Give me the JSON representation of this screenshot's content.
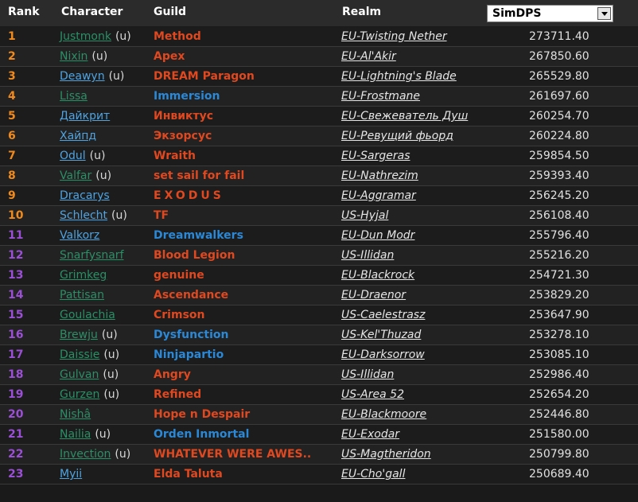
{
  "header": {
    "rank": "Rank",
    "character": "Character",
    "guild": "Guild",
    "realm": "Realm",
    "metric": "SimDPS"
  },
  "colors": {
    "rank_top10": "#f08a1c",
    "rank_rest": "#9b4fd6",
    "guild_red": "#e0481f",
    "guild_blue": "#2a88d6",
    "char_green": "#2b8f67",
    "char_blue": "#4fa3e0"
  },
  "rows": [
    {
      "rank": "1",
      "character": "Justmonk",
      "u": "(u)",
      "guild": "Method",
      "realm": "EU-Twisting Nether",
      "score": "273711.40",
      "char_color": "green",
      "guild_color": "red",
      "rank_color": "orange"
    },
    {
      "rank": "2",
      "character": "Nixin",
      "u": "(u)",
      "guild": "Apex",
      "realm": "EU-Al'Akir",
      "score": "267850.60",
      "char_color": "green",
      "guild_color": "red",
      "rank_color": "orange"
    },
    {
      "rank": "3",
      "character": "Deawyn",
      "u": "(u)",
      "guild": "DREAM Paragon",
      "realm": "EU-Lightning's Blade",
      "score": "265529.80",
      "char_color": "blue",
      "guild_color": "red",
      "rank_color": "orange"
    },
    {
      "rank": "4",
      "character": "Lissa",
      "u": "",
      "guild": "Immersion",
      "realm": "EU-Frostmane",
      "score": "261697.60",
      "char_color": "green",
      "guild_color": "blue",
      "rank_color": "orange"
    },
    {
      "rank": "5",
      "character": "Дайкрит",
      "u": "",
      "guild": "Инвиктус",
      "realm": "EU-Свежеватель Душ",
      "score": "260254.70",
      "char_color": "blue",
      "guild_color": "red",
      "rank_color": "orange"
    },
    {
      "rank": "6",
      "character": "Хайпд",
      "u": "",
      "guild": "Экзорсус",
      "realm": "EU-Ревущий фьорд",
      "score": "260224.80",
      "char_color": "blue",
      "guild_color": "red",
      "rank_color": "orange"
    },
    {
      "rank": "7",
      "character": "Odul",
      "u": "(u)",
      "guild": "Wraith",
      "realm": "EU-Sargeras",
      "score": "259854.50",
      "char_color": "blue",
      "guild_color": "red",
      "rank_color": "orange"
    },
    {
      "rank": "8",
      "character": "Valfar",
      "u": "(u)",
      "guild": "set sail for fail",
      "realm": "EU-Nathrezim",
      "score": "259393.40",
      "char_color": "green",
      "guild_color": "red",
      "rank_color": "orange"
    },
    {
      "rank": "9",
      "character": "Dracarys",
      "u": "",
      "guild": "EXODUS",
      "realm": "EU-Aggramar",
      "score": "256245.20",
      "char_color": "blue",
      "guild_color": "red",
      "rank_color": "orange",
      "wide": true
    },
    {
      "rank": "10",
      "character": "Schlecht",
      "u": "(u)",
      "guild": "TF",
      "realm": "US-Hyjal",
      "score": "256108.40",
      "char_color": "blue",
      "guild_color": "red",
      "rank_color": "orange"
    },
    {
      "rank": "11",
      "character": "Valkorz",
      "u": "",
      "guild": "Dreamwalkers",
      "realm": "EU-Dun Modr",
      "score": "255796.40",
      "char_color": "blue",
      "guild_color": "blue",
      "rank_color": "purple"
    },
    {
      "rank": "12",
      "character": "Snarfysnarf",
      "u": "",
      "guild": "Blood Legion",
      "realm": "US-Illidan",
      "score": "255216.20",
      "char_color": "green",
      "guild_color": "red",
      "rank_color": "purple"
    },
    {
      "rank": "13",
      "character": "Grimkeg",
      "u": "",
      "guild": "genuine",
      "realm": "EU-Blackrock",
      "score": "254721.30",
      "char_color": "green",
      "guild_color": "red",
      "rank_color": "purple"
    },
    {
      "rank": "14",
      "character": "Pattisan",
      "u": "",
      "guild": "Ascendance",
      "realm": "EU-Draenor",
      "score": "253829.20",
      "char_color": "green",
      "guild_color": "red",
      "rank_color": "purple"
    },
    {
      "rank": "15",
      "character": "Goulachia",
      "u": "",
      "guild": "Crimson",
      "realm": "US-Caelestrasz",
      "score": "253647.90",
      "char_color": "green",
      "guild_color": "red",
      "rank_color": "purple"
    },
    {
      "rank": "16",
      "character": "Brewju",
      "u": "(u)",
      "guild": "Dysfunction",
      "realm": "US-Kel'Thuzad",
      "score": "253278.10",
      "char_color": "green",
      "guild_color": "blue",
      "rank_color": "purple"
    },
    {
      "rank": "17",
      "character": "Daissie",
      "u": "(u)",
      "guild": "Ninjapartio",
      "realm": "EU-Darksorrow",
      "score": "253085.10",
      "char_color": "green",
      "guild_color": "blue",
      "rank_color": "purple"
    },
    {
      "rank": "18",
      "character": "Gulvan",
      "u": "(u)",
      "guild": "Angry",
      "realm": "US-Illidan",
      "score": "252986.40",
      "char_color": "green",
      "guild_color": "red",
      "rank_color": "purple"
    },
    {
      "rank": "19",
      "character": "Gurzen",
      "u": "(u)",
      "guild": "Refined",
      "realm": "US-Area 52",
      "score": "252654.20",
      "char_color": "green",
      "guild_color": "red",
      "rank_color": "purple"
    },
    {
      "rank": "20",
      "character": "Nishâ",
      "u": "",
      "guild": "Hope n Despair",
      "realm": "EU-Blackmoore",
      "score": "252446.80",
      "char_color": "green",
      "guild_color": "red",
      "rank_color": "purple"
    },
    {
      "rank": "21",
      "character": "Nailia",
      "u": "(u)",
      "guild": "Orden Inmortal",
      "realm": "EU-Exodar",
      "score": "251580.00",
      "char_color": "green",
      "guild_color": "blue",
      "rank_color": "purple"
    },
    {
      "rank": "22",
      "character": "Invection",
      "u": "(u)",
      "guild": "WHATEVER WERE AWES..",
      "realm": "US-Magtheridon",
      "score": "250799.80",
      "char_color": "green",
      "guild_color": "red",
      "rank_color": "purple"
    },
    {
      "rank": "23",
      "character": "Myii",
      "u": "",
      "guild": "Elda Taluta",
      "realm": "EU-Cho'gall",
      "score": "250689.40",
      "char_color": "blue",
      "guild_color": "red",
      "rank_color": "purple"
    }
  ]
}
